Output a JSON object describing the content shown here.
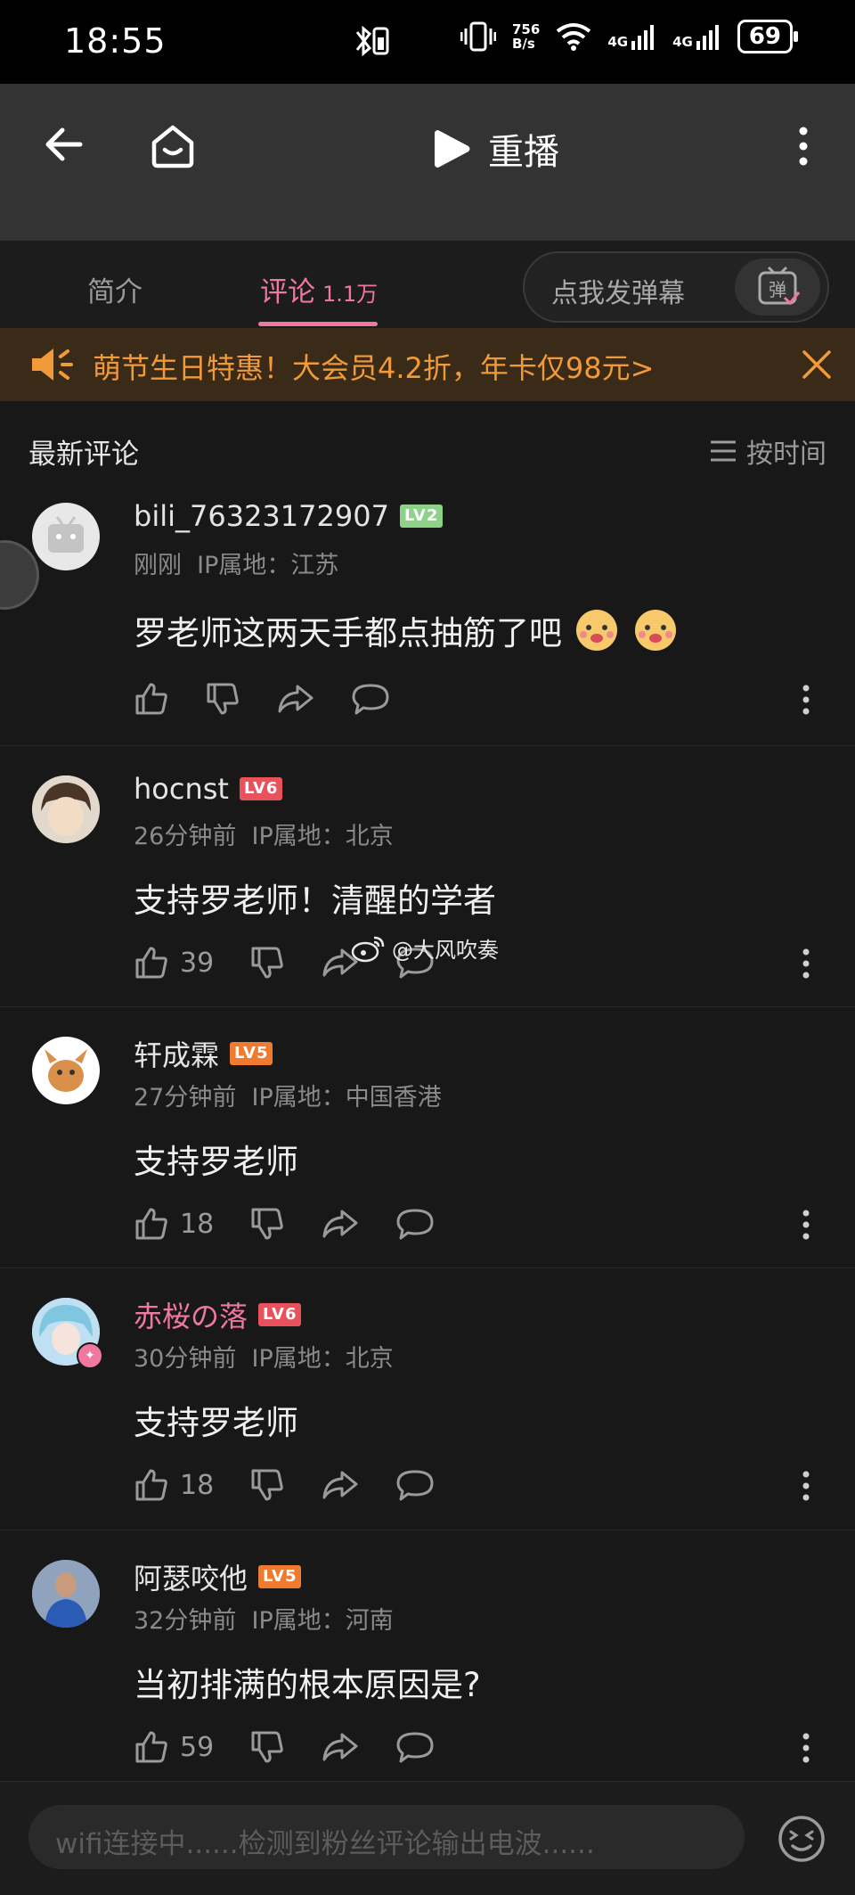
{
  "status_bar": {
    "time": "18:55",
    "network_speed": "756\nB/s",
    "signal_1": "4G",
    "signal_2": "4G",
    "battery": "69"
  },
  "player": {
    "replay_label": "重播"
  },
  "tabs": [
    {
      "label": "简介"
    },
    {
      "label": "评论",
      "count": "1.1万"
    }
  ],
  "danmaku": {
    "placeholder": "点我发弹幕",
    "button_char": "弹"
  },
  "banner": {
    "text": "萌节生日特惠！大会员4.2折，年卡仅98元>"
  },
  "comments_header": {
    "title": "最新评论",
    "sort_label": "按时间"
  },
  "comments": [
    {
      "username": "bili_76323172907",
      "level": "LV2",
      "level_color": "#8ed189",
      "time": "刚刚",
      "ip": "IP属地：江苏",
      "text": "罗老师这两天手都点抽筋了吧",
      "likes": "",
      "vip": false
    },
    {
      "username": "hocnst",
      "level": "LV6",
      "level_color": "#e8525c",
      "time": "26分钟前",
      "ip": "IP属地：北京",
      "text": "支持罗老师！清醒的学者",
      "likes": "39",
      "vip": false
    },
    {
      "username": "轩成霖",
      "level": "LV5",
      "level_color": "#f07b2e",
      "time": "27分钟前",
      "ip": "IP属地：中国香港",
      "text": "支持罗老师",
      "likes": "18",
      "vip": false
    },
    {
      "username": "赤桜の落",
      "level": "LV6",
      "level_color": "#e8525c",
      "time": "30分钟前",
      "ip": "IP属地：北京",
      "text": "支持罗老师",
      "likes": "18",
      "vip": true
    },
    {
      "username": "阿瑟咬他",
      "level": "LV5",
      "level_color": "#f07b2e",
      "time": "32分钟前",
      "ip": "IP属地：河南",
      "text": "当初排满的根本原因是?",
      "likes": "59",
      "vip": false
    }
  ],
  "watermark": {
    "text": "@大风吹奏"
  },
  "bottom_input": {
    "placeholder": "wifi连接中......检测到粉丝评论输出电波......"
  },
  "colors": {
    "accent_pink": "#f0789e",
    "banner_orange": "#f29a3a",
    "background": "#181818"
  }
}
